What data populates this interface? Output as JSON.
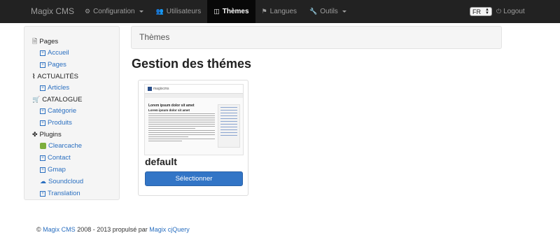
{
  "navbar": {
    "brand": "Magix CMS",
    "items": [
      {
        "label": "Configuration",
        "icon": "gear-icon",
        "dropdown": true,
        "active": false
      },
      {
        "label": "Utilisateurs",
        "icon": "users-icon",
        "dropdown": false,
        "active": false
      },
      {
        "label": "Thèmes",
        "icon": "columns-icon",
        "dropdown": false,
        "active": true
      },
      {
        "label": "Langues",
        "icon": "flag-icon",
        "dropdown": false,
        "active": false
      },
      {
        "label": "Outils",
        "icon": "wrench-icon",
        "dropdown": true,
        "active": false
      }
    ],
    "language": "FR",
    "logout": "Logout"
  },
  "sidebar": {
    "sections": [
      {
        "label": "Pages",
        "icon": "file-icon",
        "items": [
          "Accueil",
          "Pages"
        ]
      },
      {
        "label": "ACTUALITÉS",
        "icon": "rss-icon",
        "items": [
          "Articles"
        ]
      },
      {
        "label": "CATALOGUE",
        "icon": "cart-icon",
        "items": [
          "Catégorie",
          "Produits"
        ]
      },
      {
        "label": "Plugins",
        "icon": "puzzle-icon",
        "items": [
          "Clearcache",
          "Contact",
          "Gmap",
          "Soundcloud",
          "Translation"
        ]
      }
    ]
  },
  "breadcrumb": "Thèmes",
  "page_title": "Gestion des thémes",
  "theme": {
    "preview_logo_text": "magixcms",
    "preview_heading1": "Lorem ipsum dolor sit amet",
    "preview_heading2": "Lorem ipsum dolor sit amet",
    "name": "default",
    "select_label": "Sélectionner"
  },
  "footer": {
    "copyright": "©",
    "brand_link": "Magix CMS",
    "years": "2008 - 2013 propulsé par",
    "engine_link": "Magix cjQuery"
  },
  "colors": {
    "navbar_bg": "#222222",
    "link": "#2a6fc0",
    "primary_button": "#3275c6"
  }
}
